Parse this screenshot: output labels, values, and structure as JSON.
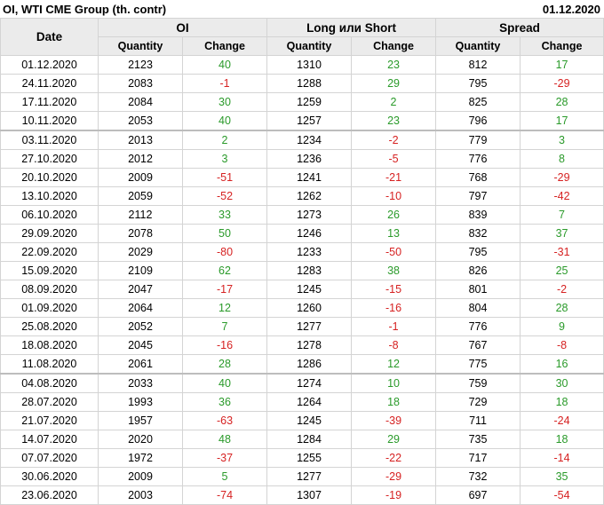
{
  "header": {
    "title": "OI, WTI CME Group (th. contr)",
    "date": "01.12.2020"
  },
  "table": {
    "col_date": "Date",
    "groups": [
      "OI",
      "Long или Short",
      "Spread"
    ],
    "sub": [
      "Quantity",
      "Change"
    ],
    "colors": {
      "positive": "#2a9a2a",
      "negative": "#d62222"
    },
    "separator_rows": [
      4,
      17
    ],
    "rows": [
      [
        "01.12.2020",
        "2123",
        "40",
        "1310",
        "23",
        "812",
        "17"
      ],
      [
        "24.11.2020",
        "2083",
        "-1",
        "1288",
        "29",
        "795",
        "-29"
      ],
      [
        "17.11.2020",
        "2084",
        "30",
        "1259",
        "2",
        "825",
        "28"
      ],
      [
        "10.11.2020",
        "2053",
        "40",
        "1257",
        "23",
        "796",
        "17"
      ],
      [
        "03.11.2020",
        "2013",
        "2",
        "1234",
        "-2",
        "779",
        "3"
      ],
      [
        "27.10.2020",
        "2012",
        "3",
        "1236",
        "-5",
        "776",
        "8"
      ],
      [
        "20.10.2020",
        "2009",
        "-51",
        "1241",
        "-21",
        "768",
        "-29"
      ],
      [
        "13.10.2020",
        "2059",
        "-52",
        "1262",
        "-10",
        "797",
        "-42"
      ],
      [
        "06.10.2020",
        "2112",
        "33",
        "1273",
        "26",
        "839",
        "7"
      ],
      [
        "29.09.2020",
        "2078",
        "50",
        "1246",
        "13",
        "832",
        "37"
      ],
      [
        "22.09.2020",
        "2029",
        "-80",
        "1233",
        "-50",
        "795",
        "-31"
      ],
      [
        "15.09.2020",
        "2109",
        "62",
        "1283",
        "38",
        "826",
        "25"
      ],
      [
        "08.09.2020",
        "2047",
        "-17",
        "1245",
        "-15",
        "801",
        "-2"
      ],
      [
        "01.09.2020",
        "2064",
        "12",
        "1260",
        "-16",
        "804",
        "28"
      ],
      [
        "25.08.2020",
        "2052",
        "7",
        "1277",
        "-1",
        "776",
        "9"
      ],
      [
        "18.08.2020",
        "2045",
        "-16",
        "1278",
        "-8",
        "767",
        "-8"
      ],
      [
        "11.08.2020",
        "2061",
        "28",
        "1286",
        "12",
        "775",
        "16"
      ],
      [
        "04.08.2020",
        "2033",
        "40",
        "1274",
        "10",
        "759",
        "30"
      ],
      [
        "28.07.2020",
        "1993",
        "36",
        "1264",
        "18",
        "729",
        "18"
      ],
      [
        "21.07.2020",
        "1957",
        "-63",
        "1245",
        "-39",
        "711",
        "-24"
      ],
      [
        "14.07.2020",
        "2020",
        "48",
        "1284",
        "29",
        "735",
        "18"
      ],
      [
        "07.07.2020",
        "1972",
        "-37",
        "1255",
        "-22",
        "717",
        "-14"
      ],
      [
        "30.06.2020",
        "2009",
        "5",
        "1277",
        "-29",
        "732",
        "35"
      ],
      [
        "23.06.2020",
        "2003",
        "-74",
        "1307",
        "-19",
        "697",
        "-54"
      ]
    ]
  }
}
